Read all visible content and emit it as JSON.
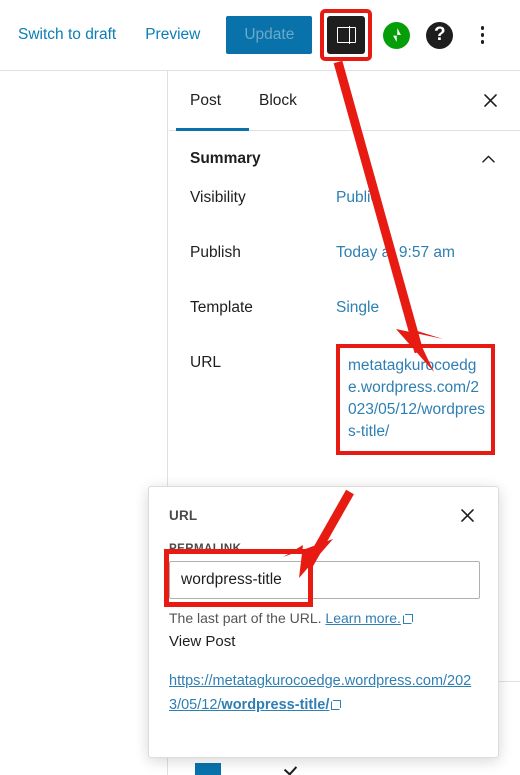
{
  "toolbar": {
    "switch_to_draft": "Switch to draft",
    "preview": "Preview",
    "update": "Update",
    "settings_icon": "sidebar-panel-icon",
    "jetpack_icon": "jetpack-icon",
    "help_icon": "help-question-icon",
    "more_icon": "three-dots-vertical-icon"
  },
  "sidebar": {
    "tabs": [
      {
        "label": "Post",
        "active": true
      },
      {
        "label": "Block",
        "active": false
      }
    ],
    "close_icon": "close-x-icon",
    "summary": {
      "title": "Summary",
      "collapse_icon": "chevron-up-icon",
      "rows": [
        {
          "label": "Visibility",
          "value": "Public"
        },
        {
          "label": "Publish",
          "value": "Today at 9:57 am"
        },
        {
          "label": "Template",
          "value": "Single"
        },
        {
          "label": "URL",
          "value": "metatagkurocoedge.wordpress.com/2023/05/12/wordpress-title/"
        }
      ]
    }
  },
  "url_popover": {
    "title": "URL",
    "close_icon": "close-x-icon",
    "permalink_label": "PERMALINK",
    "permalink_value": "wordpress-title",
    "help_text": "The last part of the URL.",
    "learn_more": "Learn more.",
    "external_icon": "external-link-icon",
    "view_post_label": "View Post",
    "full_url_prefix": "https://metatagkurocoedge.wordpress.com/2023/05/12/",
    "full_url_slug": "wordpress-title/"
  },
  "annotations": {
    "accent_color": "#e81b12",
    "highlights": [
      "settings-toggle-highlight",
      "url-value-highlight",
      "permalink-input-highlight"
    ],
    "arrows": [
      "arrow-settings-to-url",
      "arrow-to-permalink-input"
    ]
  },
  "colors": {
    "link_blue": "#2e7fb3",
    "button_blue": "#0a72ab",
    "jetpack_green": "#069e08",
    "annotation_red": "#e81b12",
    "text_dark": "#1e1e1e"
  }
}
